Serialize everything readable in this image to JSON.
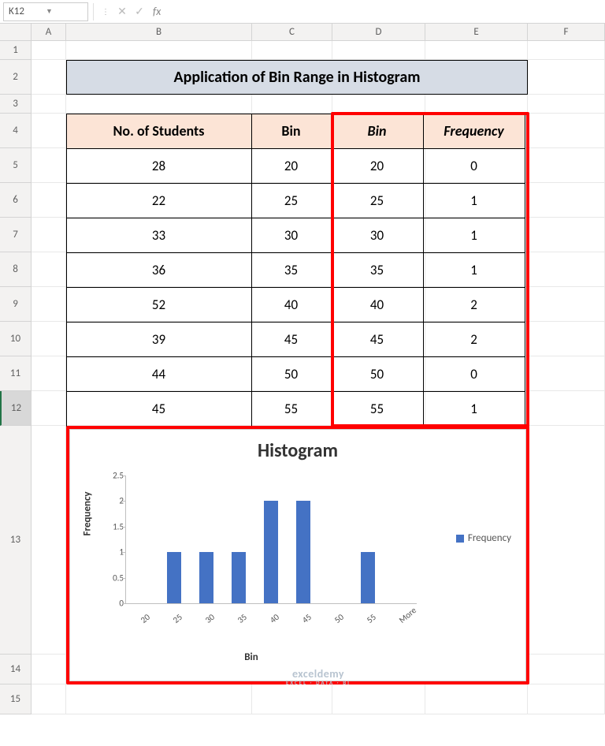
{
  "formula_bar": {
    "name_box": "K12",
    "fx_label": "fx"
  },
  "columns": [
    "A",
    "B",
    "C",
    "D",
    "E",
    "F"
  ],
  "row_labels": [
    "1",
    "2",
    "3",
    "4",
    "5",
    "6",
    "7",
    "8",
    "9",
    "10",
    "11",
    "12",
    "13",
    "14",
    "15"
  ],
  "title": "Application of Bin Range in Histogram",
  "table": {
    "headers": [
      "No. of Students",
      "Bin",
      "Bin",
      "Frequency"
    ],
    "rows": [
      [
        "28",
        "20",
        "20",
        "0"
      ],
      [
        "22",
        "25",
        "25",
        "1"
      ],
      [
        "33",
        "30",
        "30",
        "1"
      ],
      [
        "36",
        "35",
        "35",
        "1"
      ],
      [
        "52",
        "40",
        "40",
        "2"
      ],
      [
        "39",
        "45",
        "45",
        "2"
      ],
      [
        "44",
        "50",
        "50",
        "0"
      ],
      [
        "45",
        "55",
        "55",
        "1"
      ]
    ]
  },
  "chart_data": {
    "type": "bar",
    "title": "Histogram",
    "xlabel": "Bin",
    "ylabel": "Frequency",
    "categories": [
      "20",
      "25",
      "30",
      "35",
      "40",
      "45",
      "50",
      "55",
      "More"
    ],
    "values": [
      0,
      1,
      1,
      1,
      2,
      2,
      0,
      1,
      0
    ],
    "ylim": [
      0,
      2.5
    ],
    "y_ticks": [
      0,
      0.5,
      1,
      1.5,
      2,
      2.5
    ],
    "legend": "Frequency"
  },
  "watermark": {
    "main": "exceldemy",
    "sub": "EXCEL · DATA · BI"
  }
}
